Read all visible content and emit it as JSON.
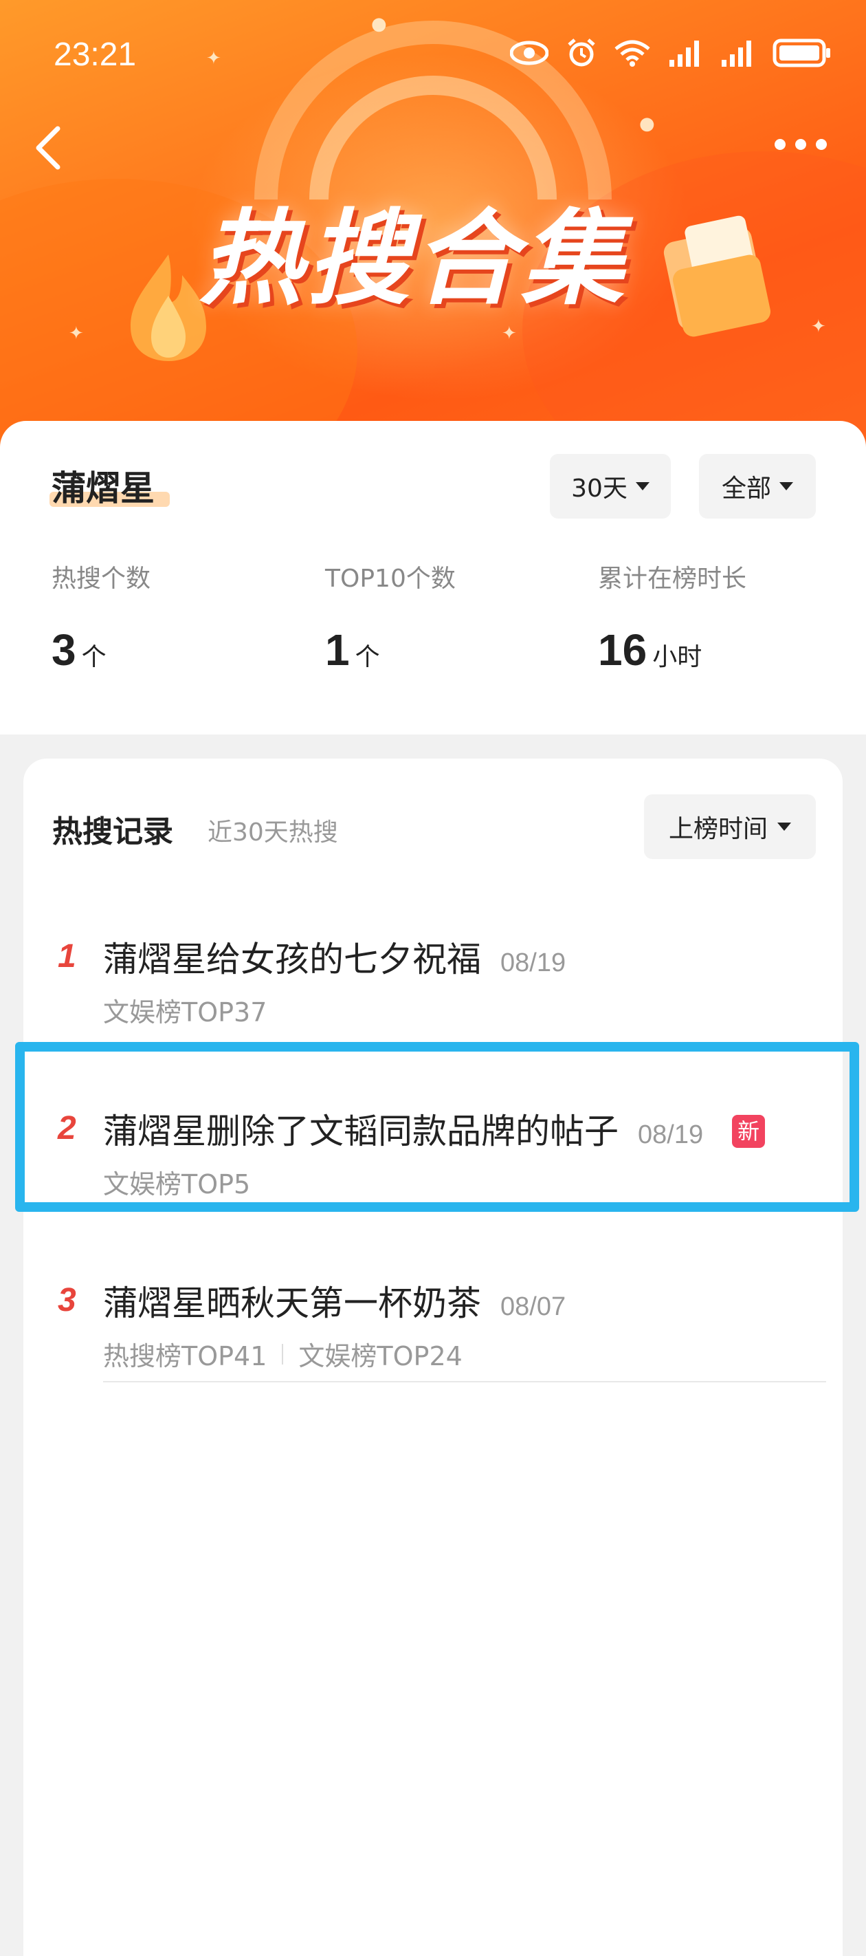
{
  "status_bar": {
    "time": "23:21",
    "icons": [
      "eye-icon",
      "alarm-icon",
      "wifi-icon",
      "signal-icon",
      "signal-icon",
      "battery-icon"
    ]
  },
  "header": {
    "title": "热搜合集",
    "back_icon": "chevron-left-icon",
    "more_icon": "more-dots-icon"
  },
  "summary": {
    "name": "蒲熠星",
    "filters": {
      "days": "30天",
      "scope": "全部"
    },
    "stats": [
      {
        "label": "热搜个数",
        "value": "3",
        "unit": "个"
      },
      {
        "label": "TOP10个数",
        "value": "1",
        "unit": "个"
      },
      {
        "label": "累计在榜时长",
        "value": "16",
        "unit": "小时"
      }
    ]
  },
  "records": {
    "title": "热搜记录",
    "subtitle": "近30天热搜",
    "sort_label": "上榜时间",
    "items": [
      {
        "rank": "1",
        "title": "蒲熠星给女孩的七夕祝福",
        "date": "08/19",
        "tags": [
          "文娱榜TOP37"
        ]
      },
      {
        "rank": "2",
        "title": "蒲熠星删除了文韬同款品牌的帖子",
        "date": "08/19",
        "badge": "新",
        "tags": [
          "文娱榜TOP5"
        ]
      },
      {
        "rank": "3",
        "title": "蒲熠星晒秋天第一杯奶茶",
        "date": "08/07",
        "tags": [
          "热搜榜TOP41",
          "文娱榜TOP24"
        ]
      }
    ]
  },
  "colors": {
    "banner_orange": "#ff7a1e",
    "rank_red": "#e8453c",
    "badge_pink": "#f2435f",
    "highlight_blue": "#29b5ee"
  }
}
